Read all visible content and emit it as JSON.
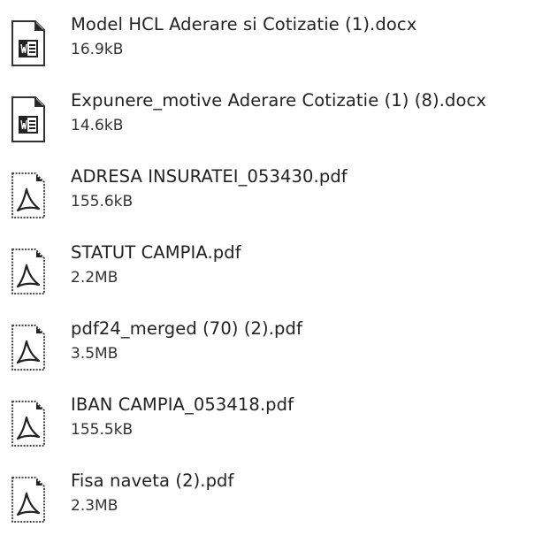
{
  "files": [
    {
      "name": "Model HCL Aderare si Cotizatie (1).docx",
      "size": "16.9kB",
      "icon": "word-document-icon"
    },
    {
      "name": "Expunere_motive Aderare  Cotizatie (1) (8).docx",
      "size": "14.6kB",
      "icon": "word-document-icon"
    },
    {
      "name": "ADRESA INSURATEI_053430.pdf",
      "size": "155.6kB",
      "icon": "pdf-document-icon"
    },
    {
      "name": "STATUT CAMPIA.pdf",
      "size": "2.2MB",
      "icon": "pdf-document-icon"
    },
    {
      "name": "pdf24_merged (70) (2).pdf",
      "size": "3.5MB",
      "icon": "pdf-document-icon"
    },
    {
      "name": "IBAN CAMPIA_053418.pdf",
      "size": "155.5kB",
      "icon": "pdf-document-icon"
    },
    {
      "name": "Fisa naveta (2).pdf",
      "size": "2.3MB",
      "icon": "pdf-document-icon"
    }
  ]
}
